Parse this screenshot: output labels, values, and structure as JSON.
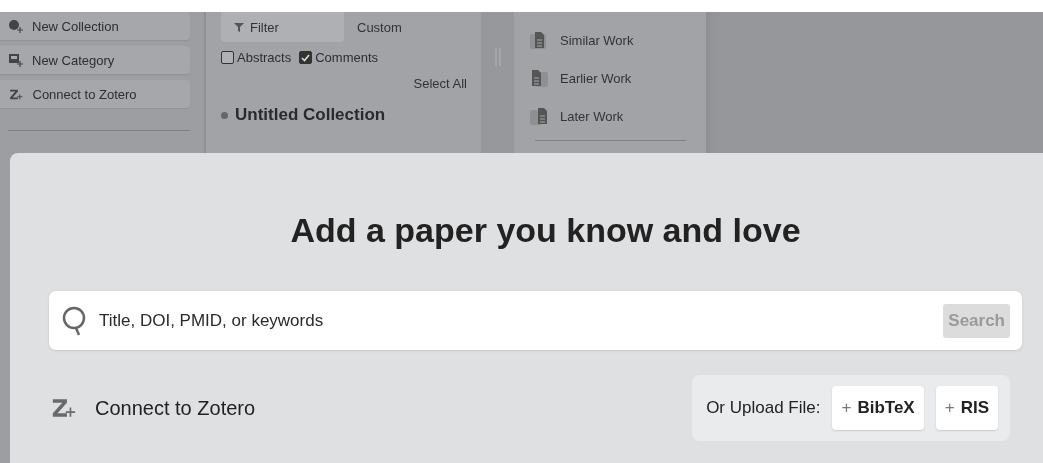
{
  "sidebar": {
    "items": [
      {
        "label": "New Collection",
        "kind": "collection"
      },
      {
        "label": "New Category",
        "kind": "category"
      },
      {
        "label": "Connect to Zotero",
        "kind": "zotero"
      }
    ]
  },
  "collection_panel": {
    "tabs": [
      {
        "label": "Filter",
        "selected": true
      },
      {
        "label": "Custom",
        "selected": false
      }
    ],
    "options": [
      {
        "label": "Abstracts",
        "checked": false
      },
      {
        "label": "Comments",
        "checked": true
      }
    ],
    "select_all": "Select All",
    "collection_title": "Untitled Collection"
  },
  "relations": {
    "items": [
      {
        "label": "Similar Work",
        "kind": "similar"
      },
      {
        "label": "Earlier Work",
        "kind": "earlier"
      },
      {
        "label": "Later Work",
        "kind": "later"
      }
    ]
  },
  "dialog": {
    "title": "Add a paper you know and love",
    "search": {
      "placeholder": "Title, DOI, PMID, or keywords",
      "button": "Search",
      "disabled": true
    },
    "zotero_link": "Connect to Zotero",
    "upload": {
      "label": "Or Upload File:",
      "buttons": [
        {
          "icon": "+",
          "label": "BibTeX"
        },
        {
          "icon": "+",
          "label": "RIS"
        }
      ]
    }
  }
}
